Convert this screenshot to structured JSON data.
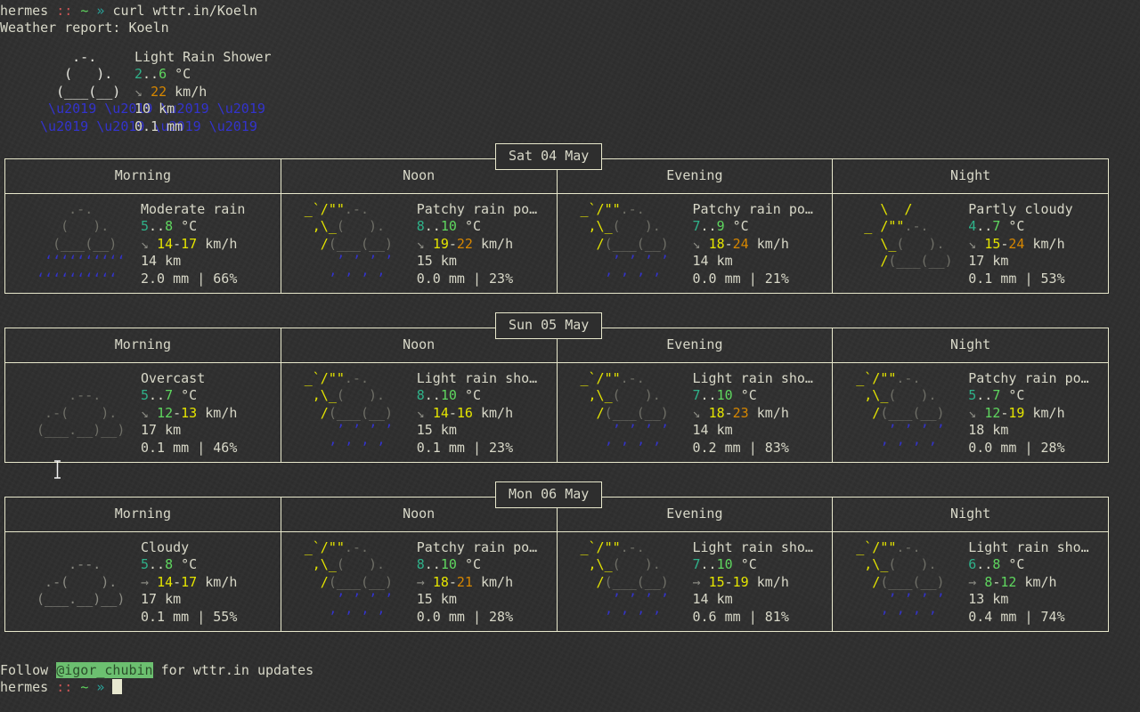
{
  "terminal": {
    "background_color": "#2e2e2e",
    "foreground_color": "#d8d8c8",
    "border_color": "#e8e8cc",
    "prompt": {
      "user": "hermes",
      "sep1": "::",
      "path": "~",
      "arrow": "»",
      "command": "curl wttr.in/Koeln"
    },
    "prompt_bottom": {
      "user": "hermes",
      "sep1": "::",
      "path": "~",
      "arrow": "»"
    },
    "report_title": "Weather report: Koeln"
  },
  "current": {
    "art": [
      "     .-.    ",
      "    (   ).  ",
      "   (___(__) ",
      "    ’ ’ ’ ’ ",
      "   ’ ’ ’ ’  "
    ],
    "condition": "Light Rain Shower",
    "temp_low": "2",
    "temp_sep": "..",
    "temp_high": "6",
    "temp_unit": "°C",
    "wind_arrow": "↘",
    "wind_speed": "22",
    "wind_unit": "km/h",
    "visibility": "10 km",
    "precip": "0.1 mm"
  },
  "columns": [
    "Morning",
    "Noon",
    "Evening",
    "Night"
  ],
  "days": [
    {
      "date": "Sat 04 May",
      "cells": [
        {
          "art_kind": "heavy-rain",
          "condition": "Moderate rain",
          "temp_low": "5",
          "temp_sep": "..",
          "temp_high": "8",
          "temp_unit": "°C",
          "wind_arrow": "↘",
          "wind_low": "14",
          "wind_high": "17",
          "wind_unit": "km/h",
          "visibility": "14 km",
          "precip": "2.0 mm",
          "chance": "66%"
        },
        {
          "art_kind": "sun-rain",
          "condition": "Patchy rain po…",
          "temp_low": "8",
          "temp_sep": "..",
          "temp_high": "10",
          "temp_unit": "°C",
          "wind_arrow": "↘",
          "wind_low": "19",
          "wind_high": "22",
          "wind_unit": "km/h",
          "visibility": "15 km",
          "precip": "0.0 mm",
          "chance": "23%"
        },
        {
          "art_kind": "sun-rain",
          "condition": "Patchy rain po…",
          "temp_low": "7",
          "temp_sep": "..",
          "temp_high": "9",
          "temp_unit": "°C",
          "wind_arrow": "↘",
          "wind_low": "18",
          "wind_high": "24",
          "wind_unit": "km/h",
          "visibility": "14 km",
          "precip": "0.0 mm",
          "chance": "21%"
        },
        {
          "art_kind": "partly-cloudy",
          "condition": "Partly cloudy",
          "temp_low": "4",
          "temp_sep": "..",
          "temp_high": "7",
          "temp_unit": "°C",
          "wind_arrow": "↘",
          "wind_low": "15",
          "wind_high": "24",
          "wind_unit": "km/h",
          "visibility": "17 km",
          "precip": "0.1 mm",
          "chance": "53%"
        }
      ]
    },
    {
      "date": "Sun 05 May",
      "cells": [
        {
          "art_kind": "overcast",
          "condition": "Overcast",
          "temp_low": "5",
          "temp_sep": "..",
          "temp_high": "7",
          "temp_unit": "°C",
          "wind_arrow": "↘",
          "wind_low": "12",
          "wind_high": "13",
          "wind_unit": "km/h",
          "visibility": "17 km",
          "precip": "0.1 mm",
          "chance": "46%"
        },
        {
          "art_kind": "sun-rain",
          "condition": "Light rain sho…",
          "temp_low": "8",
          "temp_sep": "..",
          "temp_high": "10",
          "temp_unit": "°C",
          "wind_arrow": "↘",
          "wind_low": "14",
          "wind_high": "16",
          "wind_unit": "km/h",
          "visibility": "15 km",
          "precip": "0.1 mm",
          "chance": "23%"
        },
        {
          "art_kind": "sun-rain",
          "condition": "Light rain sho…",
          "temp_low": "7",
          "temp_sep": "..",
          "temp_high": "10",
          "temp_unit": "°C",
          "wind_arrow": "↘",
          "wind_low": "18",
          "wind_high": "23",
          "wind_unit": "km/h",
          "visibility": "14 km",
          "precip": "0.2 mm",
          "chance": "83%"
        },
        {
          "art_kind": "sun-rain",
          "condition": "Patchy rain po…",
          "temp_low": "5",
          "temp_sep": "..",
          "temp_high": "7",
          "temp_unit": "°C",
          "wind_arrow": "↘",
          "wind_low": "12",
          "wind_high": "19",
          "wind_unit": "km/h",
          "visibility": "18 km",
          "precip": "0.0 mm",
          "chance": "28%"
        }
      ]
    },
    {
      "date": "Mon 06 May",
      "cells": [
        {
          "art_kind": "cloudy",
          "condition": "Cloudy",
          "temp_low": "5",
          "temp_sep": "..",
          "temp_high": "8",
          "temp_unit": "°C",
          "wind_arrow": "→",
          "wind_low": "14",
          "wind_high": "17",
          "wind_unit": "km/h",
          "visibility": "17 km",
          "precip": "0.1 mm",
          "chance": "55%"
        },
        {
          "art_kind": "sun-rain",
          "condition": "Patchy rain po…",
          "temp_low": "8",
          "temp_sep": "..",
          "temp_high": "10",
          "temp_unit": "°C",
          "wind_arrow": "→",
          "wind_low": "18",
          "wind_high": "21",
          "wind_unit": "km/h",
          "visibility": "15 km",
          "precip": "0.0 mm",
          "chance": "28%"
        },
        {
          "art_kind": "sun-rain",
          "condition": "Light rain sho…",
          "temp_low": "7",
          "temp_sep": "..",
          "temp_high": "10",
          "temp_unit": "°C",
          "wind_arrow": "→",
          "wind_low": "15",
          "wind_high": "19",
          "wind_unit": "km/h",
          "visibility": "14 km",
          "precip": "0.6 mm",
          "chance": "81%"
        },
        {
          "art_kind": "sun-rain",
          "condition": "Light rain sho…",
          "temp_low": "6",
          "temp_sep": "..",
          "temp_high": "8",
          "temp_unit": "°C",
          "wind_arrow": "→",
          "wind_low": "8",
          "wind_high": "12",
          "wind_unit": "km/h",
          "visibility": "13 km",
          "precip": "0.4 mm",
          "chance": "74%"
        }
      ]
    }
  ],
  "footer": {
    "prefix": "Follow ",
    "handle": "@igor_chubin",
    "suffix": " for wttr.in updates"
  }
}
